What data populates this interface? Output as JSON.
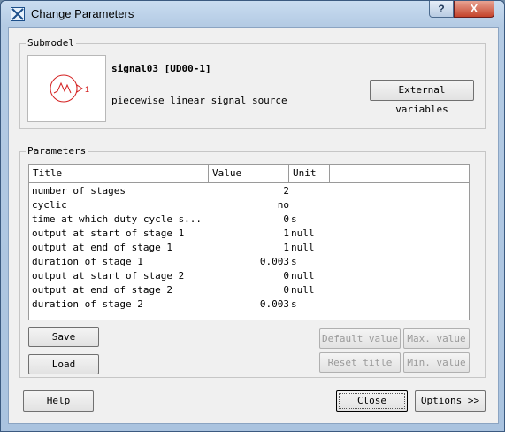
{
  "window": {
    "title": "Change Parameters",
    "help_label": "?",
    "close_label": "X"
  },
  "submodel": {
    "group_label": "Submodel",
    "name": "signal03 [UD00-1]",
    "description": "piecewise linear signal source",
    "port_label": "1",
    "external_variables_label": "External variables"
  },
  "parameters": {
    "group_label": "Parameters",
    "columns": [
      "Title",
      "Value",
      "Unit"
    ],
    "rows": [
      {
        "title": "number of stages",
        "value": "2",
        "unit": ""
      },
      {
        "title": "cyclic",
        "value": "no",
        "unit": ""
      },
      {
        "title": "time at which duty cycle s...",
        "value": "0",
        "unit": "s"
      },
      {
        "title": "output at start of stage 1",
        "value": "1",
        "unit": "null"
      },
      {
        "title": "output at end of stage 1",
        "value": "1",
        "unit": "null"
      },
      {
        "title": "duration of stage 1",
        "value": "0.003",
        "unit": "s"
      },
      {
        "title": "output at start of stage 2",
        "value": "0",
        "unit": "null"
      },
      {
        "title": "output at end of stage 2",
        "value": "0",
        "unit": "null"
      },
      {
        "title": "duration of stage 2",
        "value": "0.003",
        "unit": "s"
      }
    ],
    "save_label": "Save",
    "load_label": "Load",
    "default_value_label": "Default value",
    "max_value_label": "Max. value",
    "reset_title_label": "Reset title",
    "min_value_label": "Min. value"
  },
  "footer": {
    "help_label": "Help",
    "close_label": "Close",
    "options_label": "Options >>"
  },
  "colors": {
    "symbol_stroke": "#d42020",
    "title_bar": "#b4cbe4",
    "close_button": "#c4432b"
  }
}
